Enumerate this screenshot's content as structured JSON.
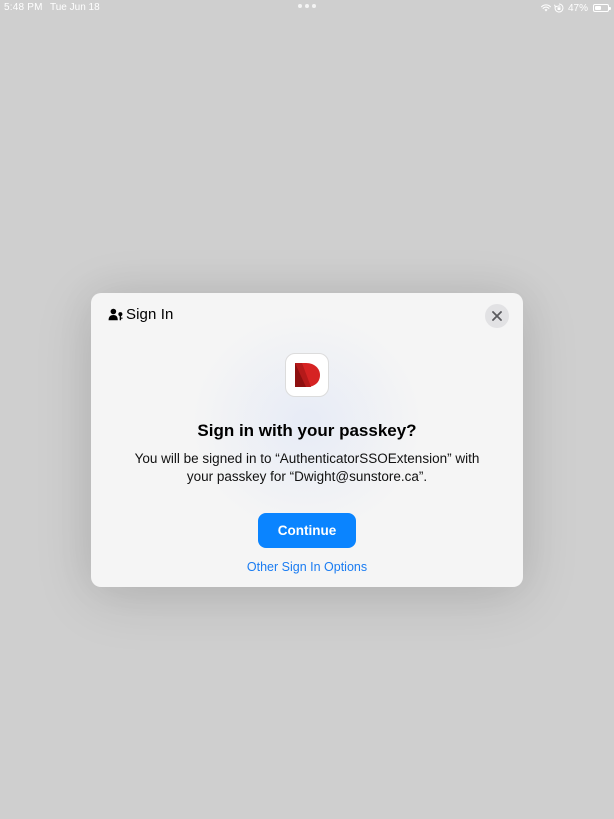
{
  "status_bar": {
    "time": "5:48 PM",
    "date": "Tue Jun 18",
    "battery_percent": "47%",
    "battery_level": 0.47,
    "icons": [
      "wifi-icon",
      "rotation-lock-icon",
      "battery-icon"
    ]
  },
  "dialog": {
    "title": "Sign In",
    "title_icon": "person-key-icon",
    "close_icon": "close-icon",
    "app_icon": "app-logo-icon",
    "headline": "Sign in with your passkey?",
    "message": "You will be signed in to “AuthenticatorSSOExtension” with your passkey for “Dwight@sunstore.ca”.",
    "continue_label": "Continue",
    "other_options_label": "Other Sign In Options"
  },
  "colors": {
    "background": "#cfcfcf",
    "accent": "#0a84ff",
    "link": "#1a7cf2",
    "logo_red": "#d62323"
  }
}
